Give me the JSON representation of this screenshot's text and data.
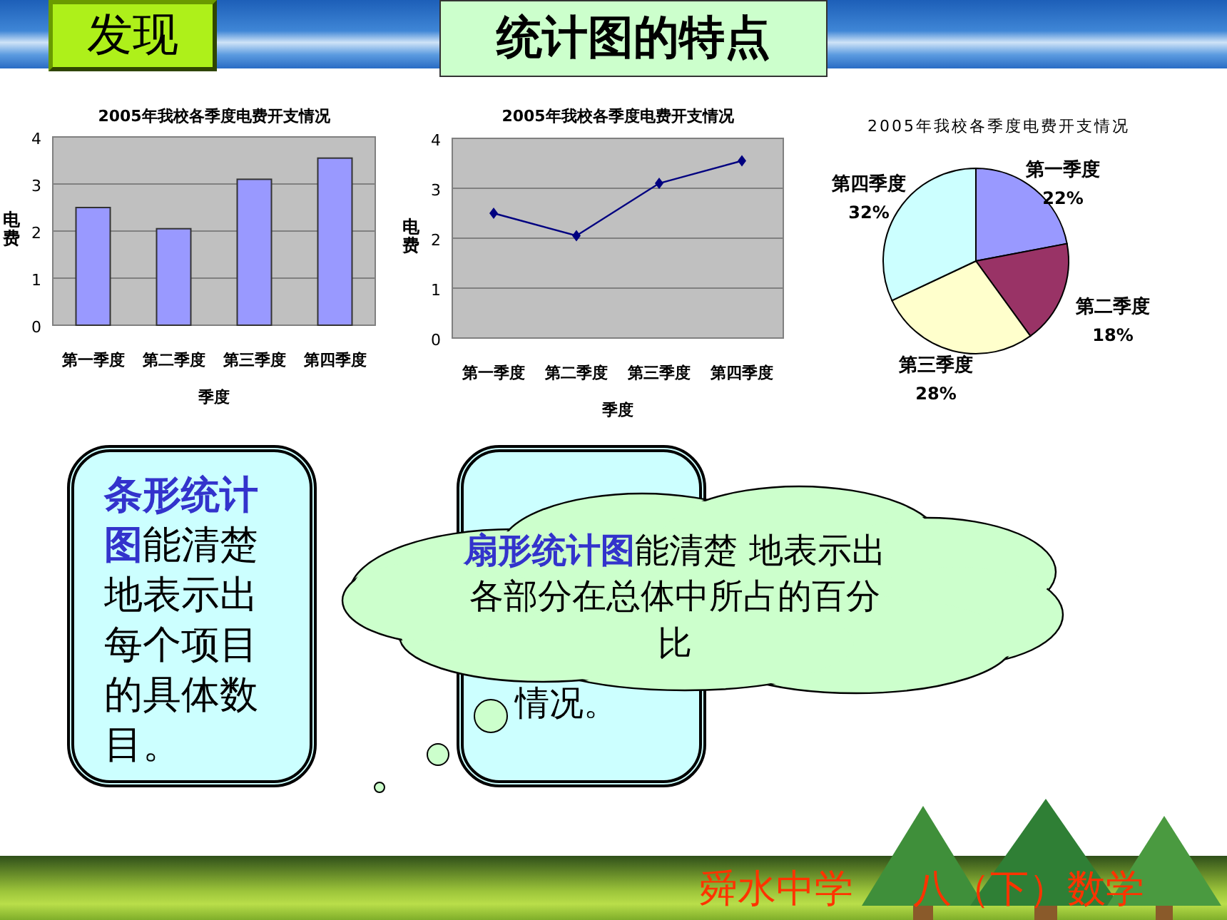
{
  "header": {
    "badge": "发现",
    "title": "统计图的特点"
  },
  "charts": [
    {
      "chart_data": {
        "type": "bar",
        "title": "2005年我校各季度电费开支情况",
        "xlabel": "季度",
        "ylabel": "电费",
        "categories": [
          "第一季度",
          "第二季度",
          "第三季度",
          "第四季度"
        ],
        "values": [
          2.5,
          2.05,
          3.1,
          3.55
        ],
        "ylim": [
          0,
          4
        ],
        "grid": true,
        "yticks": [
          {
            "value": 0,
            "label": "0"
          },
          {
            "value": 1,
            "label": "1"
          },
          {
            "value": 2,
            "label": "2"
          },
          {
            "value": 3,
            "label": "3"
          },
          {
            "value": 4,
            "label": "4"
          }
        ]
      }
    },
    {
      "chart_data": {
        "type": "line",
        "grid": true,
        "marker": "diamond",
        "title": "2005年我校各季度电费开支情况",
        "xlabel": "季度",
        "ylabel": "电费",
        "categories": [
          "第一季度",
          "第二季度",
          "第三季度",
          "第四季度"
        ],
        "values": [
          2.5,
          2.05,
          3.1,
          3.55
        ],
        "ylim": [
          0,
          4
        ],
        "yticks": [
          {
            "value": 0,
            "label": "0"
          },
          {
            "value": 1,
            "label": "1"
          },
          {
            "value": 2,
            "label": "2"
          },
          {
            "value": 3,
            "label": "3"
          },
          {
            "value": 4,
            "label": "4"
          }
        ]
      }
    },
    {
      "chart_data": {
        "type": "pie",
        "title": "2005年我校各季度电费开支情况",
        "categories": [
          "第一季度",
          "第二季度",
          "第三季度",
          "第四季度"
        ],
        "values": [
          22,
          18,
          28,
          32
        ],
        "value_labels": [
          "22%",
          "18%",
          "28%",
          "32%"
        ]
      }
    }
  ],
  "cards": [
    {
      "text": "**条形统计图**能清楚地表示出每个项目的具体数目。"
    },
    {
      "text": "情况。"
    }
  ],
  "callout": {
    "text": "**扇形统计图**能清楚 地表示出各部分在总体中所占的百分比"
  },
  "footer": {
    "school": "舜水中学",
    "course": "八（下）数学"
  }
}
